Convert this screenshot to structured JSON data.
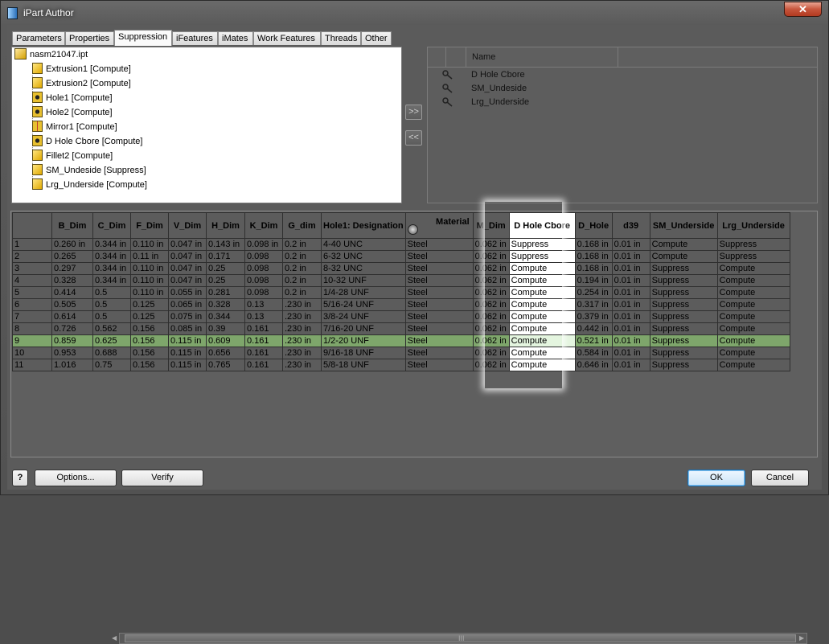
{
  "window": {
    "title": "iPart Author",
    "close_label": "✕"
  },
  "tabs": [
    "Parameters",
    "Properties",
    "Suppression",
    "iFeatures",
    "iMates",
    "Work Features",
    "Threads",
    "Other"
  ],
  "active_tab": "Suppression",
  "tree": {
    "root": "nasm21047.ipt",
    "items": [
      "Extrusion1 [Compute]",
      "Extrusion2 [Compute]",
      "Hole1 [Compute]",
      "Hole2 [Compute]",
      "Mirror1 [Compute]",
      "D Hole Cbore [Compute]",
      "Fillet2 [Compute]",
      "SM_Undeside [Suppress]",
      "Lrg_Underside [Compute]"
    ]
  },
  "move_buttons": {
    "add": ">>",
    "remove": "<<"
  },
  "selected_list": {
    "header": "Name",
    "items": [
      "D Hole Cbore",
      "SM_Undeside",
      "Lrg_Underside"
    ]
  },
  "table": {
    "columns": [
      "",
      "B_Dim",
      "C_Dim",
      "F_Dim",
      "V_Dim",
      "H_Dim",
      "K_Dim",
      "G_dim",
      "Hole1: Designation",
      "Material",
      "M_Dim",
      "D Hole Cbore",
      "D_Hole",
      "d39",
      "SM_Underside",
      "Lrg_Underside"
    ],
    "rows": [
      [
        "1",
        "0.260 in",
        "0.344 in",
        "0.110 in",
        "0.047 in",
        "0.143 in",
        "0.098 in",
        "0.2 in",
        "4-40 UNC",
        "Steel",
        "0.062 in",
        "Suppress",
        "0.168 in",
        "0.01 in",
        "Compute",
        "Suppress"
      ],
      [
        "2",
        "0.265",
        "0.344 in",
        "0.11 in",
        "0.047 in",
        "0.171",
        "0.098",
        "0.2 in",
        "6-32 UNC",
        "Steel",
        "0.062 in",
        "Suppress",
        "0.168 in",
        "0.01 in",
        "Compute",
        "Suppress"
      ],
      [
        "3",
        "0.297",
        "0.344 in",
        "0.110 in",
        "0.047 in",
        "0.25",
        "0.098",
        "0.2 in",
        "8-32 UNC",
        "Steel",
        "0.062 in",
        "Compute",
        "0.168 in",
        "0.01 in",
        "Suppress",
        "Compute"
      ],
      [
        "4",
        "0.328",
        "0.344 in",
        "0.110 in",
        "0.047 in",
        "0.25",
        "0.098",
        "0.2 in",
        "10-32 UNF",
        "Steel",
        "0.062 in",
        "Compute",
        "0.194 in",
        "0.01 in",
        "Suppress",
        "Compute"
      ],
      [
        "5",
        "0.414",
        "0.5",
        "0.110 in",
        "0.055 in",
        "0.281",
        "0.098",
        "0.2 in",
        "1/4-28 UNF",
        "Steel",
        "0.062 in",
        "Compute",
        "0.254 in",
        "0.01 in",
        "Suppress",
        "Compute"
      ],
      [
        "6",
        "0.505",
        "0.5",
        "0.125",
        "0.065 in",
        "0.328",
        "0.13",
        ".230 in",
        "5/16-24 UNF",
        "Steel",
        "0.062 in",
        "Compute",
        "0.317 in",
        "0.01 in",
        "Suppress",
        "Compute"
      ],
      [
        "7",
        "0.614",
        "0.5",
        "0.125",
        "0.075 in",
        "0.344",
        "0.13",
        ".230 in",
        "3/8-24 UNF",
        "Steel",
        "0.062 in",
        "Compute",
        "0.379 in",
        "0.01 in",
        "Suppress",
        "Compute"
      ],
      [
        "8",
        "0.726",
        "0.562",
        "0.156",
        "0.085 in",
        "0.39",
        "0.161",
        ".230 in",
        "7/16-20 UNF",
        "Steel",
        "0.062 in",
        "Compute",
        "0.442 in",
        "0.01 in",
        "Suppress",
        "Compute"
      ],
      [
        "9",
        "0.859",
        "0.625",
        "0.156",
        "0.115 in",
        "0.609",
        "0.161",
        ".230 in",
        "1/2-20 UNF",
        "Steel",
        "0.062 in",
        "Compute",
        "0.521 in",
        "0.01 in",
        "Suppress",
        "Compute"
      ],
      [
        "10",
        "0.953",
        "0.688",
        "0.156",
        "0.115 in",
        "0.656",
        "0.161",
        ".230 in",
        "9/16-18 UNF",
        "Steel",
        "0.062 in",
        "Compute",
        "0.584 in",
        "0.01 in",
        "Suppress",
        "Compute"
      ],
      [
        "11",
        "1.016",
        "0.75",
        "0.156",
        "0.115 in",
        "0.765",
        "0.161",
        ".230 in",
        "5/8-18 UNF",
        "Steel",
        "0.062 in",
        "Compute",
        "0.646 in",
        "0.01 in",
        "Suppress",
        "Compute"
      ]
    ],
    "selected_row": 9
  },
  "scrollbar": {
    "grip": "III"
  },
  "footer": {
    "help": "?",
    "options": "Options...",
    "verify": "Verify",
    "ok": "OK",
    "cancel": "Cancel"
  },
  "colors": {
    "selected_row": "#7ea66b",
    "highlight_column": "#ffffff"
  }
}
